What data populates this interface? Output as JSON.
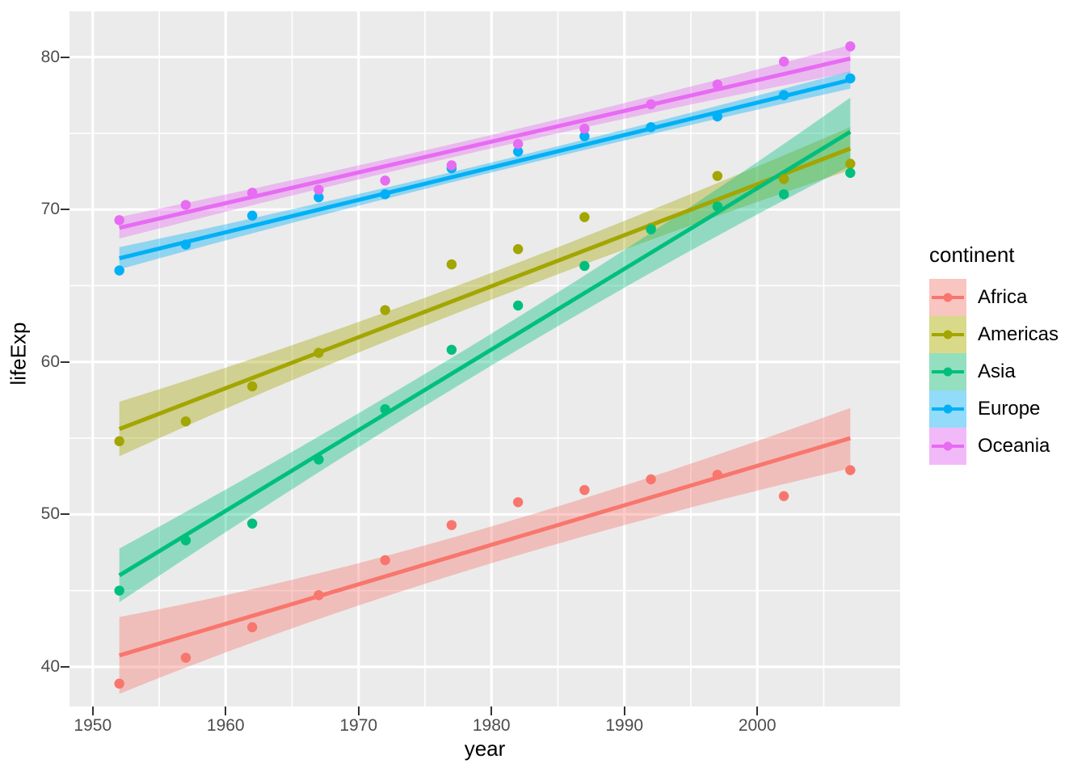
{
  "chart_data": {
    "type": "scatter",
    "title": "",
    "xlabel": "year",
    "ylabel": "lifeExp",
    "xlim": [
      1948.25,
      1060.75
    ],
    "x_range": [
      1948.25,
      2010.75
    ],
    "ylim": [
      37.4,
      83.0
    ],
    "grid": true,
    "legend_position": "right",
    "legend_title": "continent",
    "x_ticks": [
      1950,
      1960,
      1970,
      1980,
      1990,
      2000
    ],
    "x_tick_labels": [
      "1950",
      "1960",
      "1970",
      "1980",
      "1990",
      "2000"
    ],
    "y_ticks": [
      40,
      50,
      60,
      70,
      80
    ],
    "y_tick_labels": [
      "40",
      "50",
      "60",
      "70",
      "80"
    ],
    "x_minor_ticks": [
      1955,
      1965,
      1975,
      1985,
      1995,
      2005
    ],
    "y_minor_ticks": [
      45,
      55,
      65,
      75
    ],
    "x": [
      1952,
      1957,
      1962,
      1967,
      1972,
      1977,
      1982,
      1987,
      1992,
      1997,
      2002,
      2007
    ],
    "series": [
      {
        "name": "Africa",
        "color": "#F8766D",
        "ribbon_color": "#F8766D",
        "values": [
          38.9,
          40.6,
          42.6,
          44.7,
          47.0,
          49.3,
          50.8,
          51.6,
          52.3,
          52.6,
          51.2,
          52.9
        ],
        "fit_start": 40.75,
        "fit_end": 55.0,
        "band_start": [
          38.5,
          43.0
        ],
        "band_end": [
          52.8,
          57.2
        ]
      },
      {
        "name": "Americas",
        "color": "#A3A500",
        "ribbon_color": "#A3A500",
        "values": [
          54.8,
          56.1,
          58.4,
          60.6,
          63.4,
          66.4,
          67.4,
          69.5,
          68.8,
          72.2,
          72.0,
          73.0
        ],
        "fit_start": 55.6,
        "fit_end": 74.0,
        "band_start": [
          54.0,
          57.2
        ],
        "band_end": [
          72.4,
          75.6
        ]
      },
      {
        "name": "Asia",
        "color": "#00BF7D",
        "ribbon_color": "#00BF7D",
        "values": [
          45.0,
          48.3,
          49.4,
          53.6,
          56.9,
          60.8,
          63.7,
          66.3,
          68.7,
          70.2,
          71.0,
          72.4
        ],
        "fit_start": 46.0,
        "fit_end": 75.1,
        "band_start": [
          44.1,
          47.9
        ],
        "band_end": [
          73.2,
          77.2
        ]
      },
      {
        "name": "Europe",
        "color": "#00B0F6",
        "ribbon_color": "#00B0F6",
        "values": [
          66.0,
          67.7,
          69.6,
          70.8,
          71.0,
          72.7,
          73.8,
          74.8,
          75.4,
          76.1,
          77.5,
          78.6
        ],
        "fit_start": 66.8,
        "fit_end": 78.5,
        "band_start": [
          66.2,
          67.5
        ],
        "band_end": [
          77.9,
          79.1
        ]
      },
      {
        "name": "Oceania",
        "color": "#E76BF3",
        "ribbon_color": "#E76BF3",
        "values": [
          69.3,
          70.3,
          71.1,
          71.3,
          71.9,
          72.9,
          74.3,
          75.3,
          76.9,
          78.2,
          79.7,
          80.7
        ],
        "fit_start": 68.8,
        "fit_end": 79.9,
        "band_start": [
          68.0,
          69.6
        ],
        "band_end": [
          79.1,
          80.7
        ]
      }
    ]
  },
  "axes": {
    "x_title": "year",
    "y_title": "lifeExp"
  },
  "legend": {
    "title": "continent",
    "items": [
      {
        "label": "Africa",
        "color": "#F8766D",
        "fill": "#F8C5C1"
      },
      {
        "label": "Americas",
        "color": "#A3A500",
        "fill": "#D9D98A"
      },
      {
        "label": "Asia",
        "color": "#00BF7D",
        "fill": "#93DFBF"
      },
      {
        "label": "Europe",
        "color": "#00B0F6",
        "fill": "#92DBF9"
      },
      {
        "label": "Oceania",
        "color": "#E76BF3",
        "fill": "#F2B9F8"
      }
    ]
  },
  "theme": {
    "panel_bg": "#EBEBEB",
    "grid_major": "#FFFFFF",
    "grid_minor": "#FFFFFF",
    "plot_bg": "#FFFFFF",
    "tick_text": "#4D4D4D",
    "title_text": "#000000"
  }
}
